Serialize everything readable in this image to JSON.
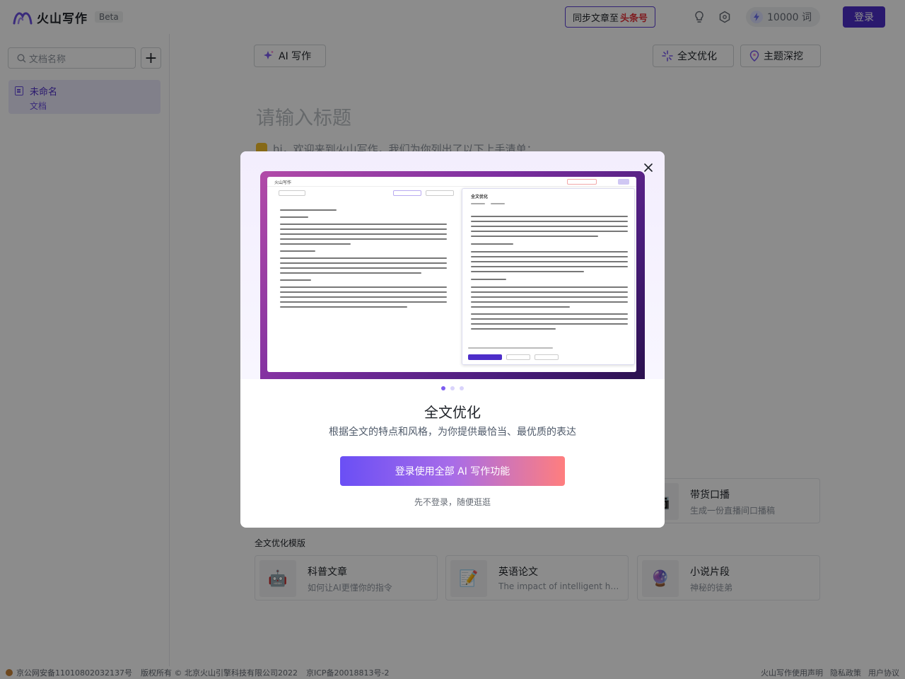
{
  "header": {
    "logo_text": "火山写作",
    "beta": "Beta",
    "sync_prefix": "同步文章至",
    "sync_brand": "头条号",
    "credits": "10000 词",
    "login": "登录"
  },
  "sidebar": {
    "search_placeholder": "文档名称",
    "add_label": "+",
    "doc_title": "未命名",
    "doc_sub": "文档"
  },
  "main": {
    "ai_write": "AI 写作",
    "optimize": "全文优化",
    "topic": "主题深挖",
    "title_placeholder": "请输入标题",
    "intro": "hi，欢迎来到火山写作，我们为你列出了以下上手清单："
  },
  "cards_top": [
    {
      "title": "带货口播",
      "desc": "生成一份直播间口播稿",
      "icon": "camera-icon"
    }
  ],
  "section": {
    "label": "全文优化模版"
  },
  "cards": [
    {
      "title": "科普文章",
      "desc": "如何让AI更懂你的指令",
      "icon": "robot-icon"
    },
    {
      "title": "英语论文",
      "desc": "The impact of intelligent hous...",
      "icon": "notepad-icon"
    },
    {
      "title": "小说片段",
      "desc": "神秘的徒弟",
      "icon": "crystal-ball-icon"
    }
  ],
  "footer": {
    "police": "京公网安备11010802032137号",
    "copyright": "版权所有 © 北京火山引擎科技有限公司2022",
    "icp": "京ICP备20018813号-2",
    "terms": "火山写作使用声明",
    "privacy": "隐私政策",
    "agreement": "用户协议"
  },
  "modal": {
    "title": "全文优化",
    "subtitle": "根据全文的特点和风格，为你提供最恰当、最优质的表达",
    "cta": "登录使用全部 AI 写作功能",
    "skip": "先不登录，随便逛逛",
    "slides": 3,
    "active_slide": 1,
    "shot": {
      "logo": "火山写作",
      "ai_write": "AI 写作",
      "optimize": "全文优化",
      "topic": "主题深挖",
      "panel_title": "全文优化",
      "btn_adopt": "替换全文",
      "btn_copy": "复制全文",
      "btn_retry": "重新生成"
    }
  },
  "colors": {
    "brand": "#4d2ec9",
    "accent": "#6b4fe0",
    "toutiao_red": "#e8323a"
  }
}
